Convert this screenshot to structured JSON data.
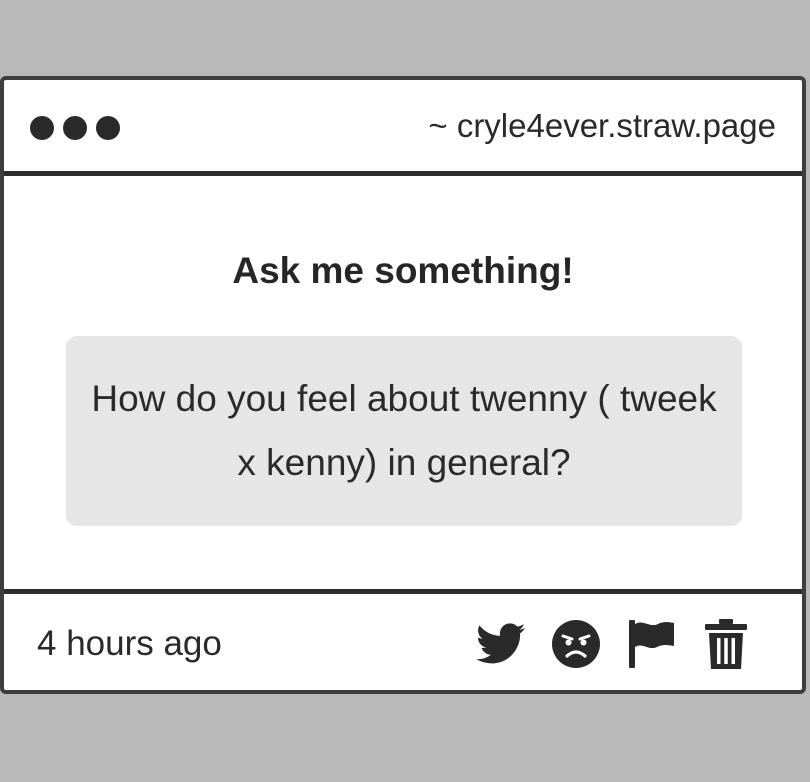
{
  "browser": {
    "url": "~ cryle4ever.straw.page"
  },
  "main": {
    "heading": "Ask me something!",
    "question": "How do you feel about twenny ( tweek x kenny) in general?"
  },
  "footer": {
    "timestamp": "4 hours ago",
    "actions": [
      {
        "icon": "twitter-icon"
      },
      {
        "icon": "angry-face-icon"
      },
      {
        "icon": "flag-icon"
      },
      {
        "icon": "trash-icon"
      }
    ]
  },
  "colors": {
    "background": "#b9b9b9",
    "card": "#ffffff",
    "border": "#2e2e2e",
    "question_box": "#e6e6e6",
    "text": "#2a2a2a"
  }
}
